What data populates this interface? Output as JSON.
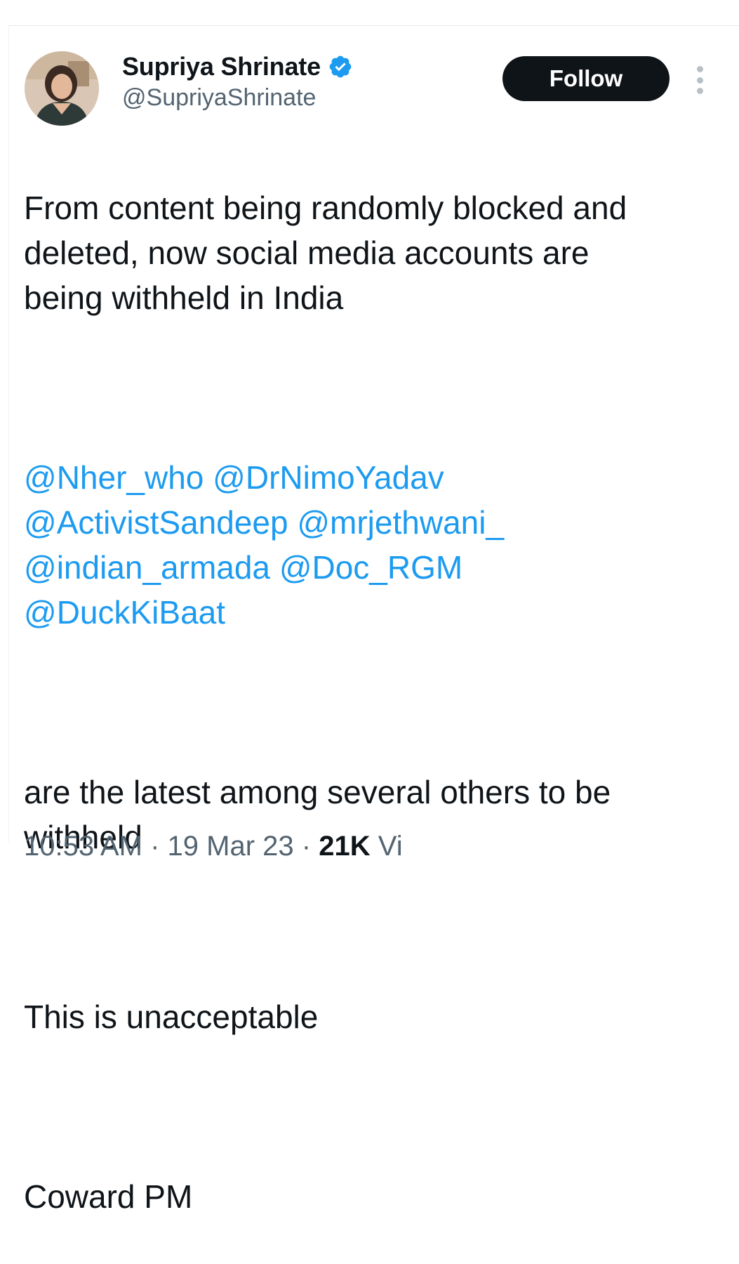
{
  "author": {
    "display_name": "Supriya Shrinate",
    "handle": "@SupriyaShrinate",
    "verified_icon": "verified-badge-icon",
    "verified_color": "#1d9bf0"
  },
  "follow_button": {
    "label": "Follow"
  },
  "more_menu": {
    "icon": "more-vertical-icon"
  },
  "tweet": {
    "paragraph_1": "From content being randomly blocked and\ndeleted, now social media accounts are\nbeing withheld in India",
    "mentions": [
      "@Nher_who",
      "@DrNimoYadav",
      "@ActivistSandeep",
      "@mrjethwani_",
      "@indian_armada",
      "@Doc_RGM",
      "@DuckKiBaat"
    ],
    "paragraph_2": "are the latest among several others to be\nwithheld",
    "paragraph_3": "This is unacceptable",
    "paragraph_4": "Coward PM"
  },
  "meta": {
    "timestamp": "10:53 AM · 19 Mar 23",
    "views_count": "21K",
    "views_label": "Vi"
  },
  "colors": {
    "text": "#0f1419",
    "secondary": "#536471",
    "link": "#1d9bf0",
    "follow_bg": "#0f1419"
  }
}
